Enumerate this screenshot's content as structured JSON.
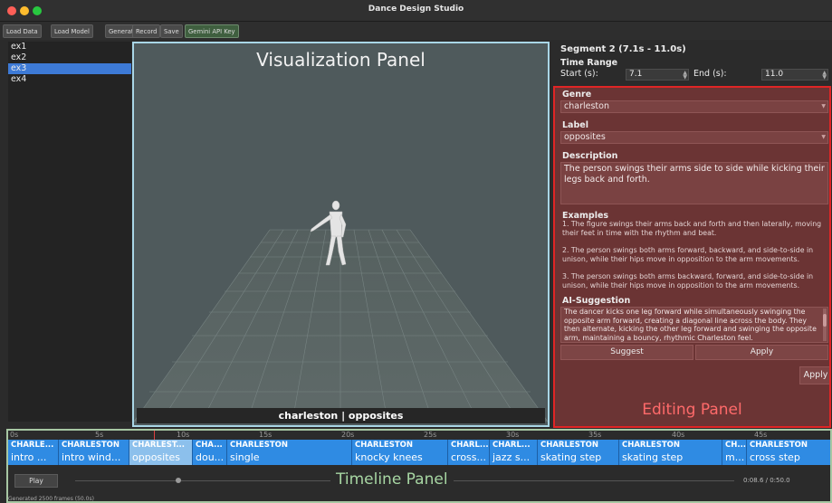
{
  "window": {
    "title": "Dance Design Studio"
  },
  "toolbar": {
    "buttons": [
      "Load Data",
      "Load Model",
      "Generate",
      "Record",
      "Save",
      "Gemini API Key"
    ]
  },
  "files": {
    "items": [
      "ex1",
      "ex2",
      "ex3",
      "ex4"
    ],
    "selected_index": 2
  },
  "visualization": {
    "title": "Visualization Panel",
    "caption": "charleston  |  opposites"
  },
  "segment": {
    "title": "Segment 2  (7.1s - 11.0s)",
    "time_range_label": "Time Range",
    "start_label": "Start (s):",
    "start_value": "7.1",
    "end_label": "End (s):",
    "end_value": "11.0"
  },
  "editor": {
    "genre_label": "Genre",
    "genre_value": "charleston",
    "label_label": "Label",
    "label_value": "opposites",
    "description_label": "Description",
    "description_value": "The person swings their arms side to side while kicking their legs back and forth.",
    "examples_label": "Examples",
    "examples": [
      "1. The figure swings their arms back and forth and then laterally, moving their feet in time with the rhythm and beat.",
      "2. The person swings both arms forward, backward, and side-to-side in unison, while their hips move in opposition to the arm movements.",
      "3. The person swings both arms backward, forward, and side-to-side in unison, while their hips move in opposition to the arm movements."
    ],
    "ai_label": "AI-Suggestion",
    "ai_text": "The dancer kicks one leg forward while simultaneously swinging the opposite arm forward, creating a diagonal line across the body. They then alternate, kicking the other leg forward and swinging the opposite arm, maintaining a bouncy, rhythmic Charleston feel.",
    "suggest_label": "Suggest",
    "apply_label": "Apply",
    "apply2_label": "Apply",
    "panel_title": "Editing Panel"
  },
  "timeline": {
    "ticks": [
      "0s",
      "5s",
      "10s",
      "15s",
      "20s",
      "25s",
      "30s",
      "35s",
      "40s",
      "45s"
    ],
    "segments": [
      {
        "genre": "CHARLE...",
        "label": "intro ..."
      },
      {
        "genre": "CHARLESTON",
        "label": "intro wind..."
      },
      {
        "genre": "CHARLEST...",
        "label": "opposites"
      },
      {
        "genre": "CHA...",
        "label": "dou..."
      },
      {
        "genre": "CHARLESTON",
        "label": "single"
      },
      {
        "genre": "CHARLESTON",
        "label": "knocky knees"
      },
      {
        "genre": "CHARL...",
        "label": "cross..."
      },
      {
        "genre": "CHARL...",
        "label": "jazz s..."
      },
      {
        "genre": "CHARLESTON",
        "label": "skating step"
      },
      {
        "genre": "CHARLESTON",
        "label": "skating step"
      },
      {
        "genre": "CH...",
        "label": "m..."
      },
      {
        "genre": "CHARLESTON",
        "label": "cross step"
      }
    ],
    "selected_segment": 2,
    "play_label": "Play",
    "title": "Timeline Panel",
    "time_readout": "0:08.6 / 0:50.0",
    "playback_position": 0.172,
    "status": "Generated 2500 frames (50.0s)"
  }
}
